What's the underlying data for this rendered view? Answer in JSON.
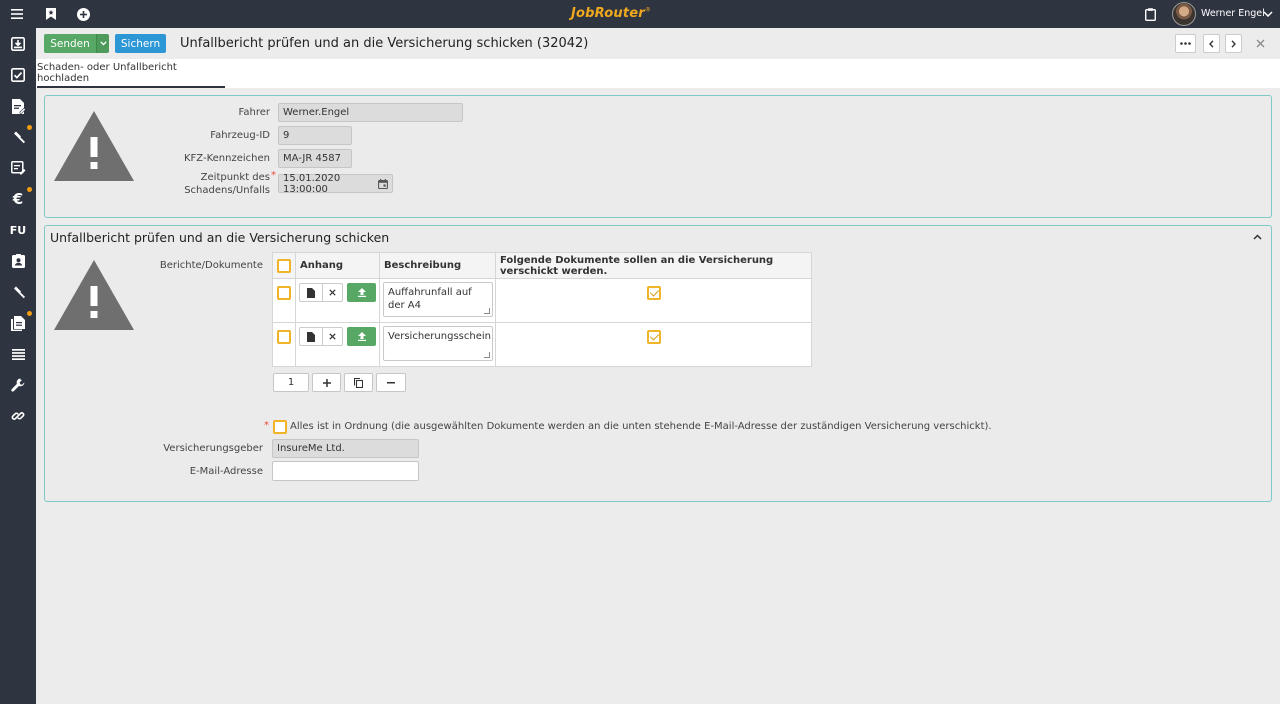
{
  "app": {
    "logo": "JobRouter",
    "logo_mark": "®",
    "user_name": "Werner Engel"
  },
  "sidebar": {
    "fu_label": "FU"
  },
  "toolbar": {
    "send_label": "Senden",
    "save_label": "Sichern"
  },
  "page_title": "Unfallbericht prüfen und an die Versicherung schicken (32042)",
  "tabs": [
    {
      "label": "Schaden- oder Unfallbericht hochladen"
    }
  ],
  "upload_section": {
    "fields": {
      "fahrer": {
        "label": "Fahrer",
        "value": "Werner.Engel"
      },
      "fahrzeug": {
        "label": "Fahrzeug-ID",
        "value": "9"
      },
      "kfz": {
        "label": "KFZ-Kennzeichen",
        "value": "MA-JR 4587"
      },
      "zeitpunkt": {
        "label_line1": "Zeitpunkt des",
        "label_line2": "Schadens/Unfalls",
        "required": "*",
        "value": "15.01.2020 13:00:00"
      }
    }
  },
  "review_section": {
    "title": "Unfallbericht prüfen und an die Versicherung schicken",
    "documents_label": "Berichte/Dokumente",
    "columns": {
      "attachment": "Anhang",
      "description": "Beschreibung",
      "send": "Folgende Dokumente sollen an die Versicherung verschickt werden."
    },
    "rows": [
      {
        "description": "Auffahrunfall auf der A4",
        "send": true
      },
      {
        "description": "Versicherungsschein",
        "send": true
      }
    ],
    "pager": {
      "page": "1"
    },
    "confirm": {
      "required": "*",
      "label": "Alles ist in Ordnung (die ausgewählten Dokumente werden an die unten stehende E-Mail-Adresse der zuständigen Versicherung verschickt)."
    },
    "insurer": {
      "label": "Versicherungsgeber",
      "value": "InsureMe Ltd."
    },
    "email": {
      "label": "E-Mail-Adresse",
      "value": ""
    }
  }
}
